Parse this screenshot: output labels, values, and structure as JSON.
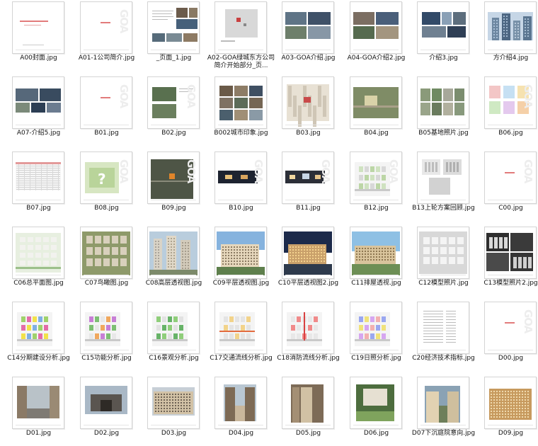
{
  "files": [
    {
      "name": "A00封面.jpg",
      "kind": "cover"
    },
    {
      "name": "A01-1公司简介.jpg",
      "kind": "blank-red"
    },
    {
      "name": "_页面_1.jpg",
      "kind": "text-photos"
    },
    {
      "name": "A02-GOA绿城东方公司简介开始部分_页...",
      "kind": "map"
    },
    {
      "name": "A03-GOA介绍.jpg",
      "kind": "photos4"
    },
    {
      "name": "A04-GOA介绍2.jpg",
      "kind": "photos4b"
    },
    {
      "name": "介绍3.jpg",
      "kind": "photos-mix"
    },
    {
      "name": "方介绍4.jpg",
      "kind": "towers"
    },
    {
      "name": "A07-介绍5.jpg",
      "kind": "aerials"
    },
    {
      "name": "B01.jpg",
      "kind": "blank-red"
    },
    {
      "name": "B02.jpg",
      "kind": "sat2"
    },
    {
      "name": "B002城市印象.jpg",
      "kind": "collage"
    },
    {
      "name": "B03.jpg",
      "kind": "map-light"
    },
    {
      "name": "B04.jpg",
      "kind": "sat-big"
    },
    {
      "name": "B05基地照片.jpg",
      "kind": "site-photos"
    },
    {
      "name": "B06.jpg",
      "kind": "diagram-color"
    },
    {
      "name": "B07.jpg",
      "kind": "table"
    },
    {
      "name": "B08.jpg",
      "kind": "green-plan"
    },
    {
      "name": "B09.jpg",
      "kind": "sat-dark"
    },
    {
      "name": "B10.jpg",
      "kind": "night-strip"
    },
    {
      "name": "B11.jpg",
      "kind": "night-strip2"
    },
    {
      "name": "B12.jpg",
      "kind": "site-plan"
    },
    {
      "name": "B13上轮方案回顾.jpg",
      "kind": "models-white"
    },
    {
      "name": "C00.jpg",
      "kind": "blank-red"
    },
    {
      "name": "C06总平面图.jpg",
      "kind": "masterplan"
    },
    {
      "name": "C07鸟瞰图.jpg",
      "kind": "birdseye"
    },
    {
      "name": "C08高层透视图.jpg",
      "kind": "highrise"
    },
    {
      "name": "C09平层透视图.jpg",
      "kind": "villa"
    },
    {
      "name": "C10平层透视图2.jpg",
      "kind": "night-villa"
    },
    {
      "name": "C11排屋透视.jpg",
      "kind": "townhouse"
    },
    {
      "name": "C12模型照片.jpg",
      "kind": "model-grey"
    },
    {
      "name": "C13模型照片2.jpg",
      "kind": "model-grey2"
    },
    {
      "name": "C14分期建设分析.jpg",
      "kind": "plan-phase"
    },
    {
      "name": "C15功能分析.jpg",
      "kind": "plan-func"
    },
    {
      "name": "C16景观分析.jpg",
      "kind": "plan-land"
    },
    {
      "name": "C17交通流线分析.jpg",
      "kind": "plan-traffic"
    },
    {
      "name": "C18消防流线分析.jpg",
      "kind": "plan-fire"
    },
    {
      "name": "C19日照分析.jpg",
      "kind": "plan-sun"
    },
    {
      "name": "C20经济技术指标.jpg",
      "kind": "list"
    },
    {
      "name": "D00.jpg",
      "kind": "blank-red"
    },
    {
      "name": "D01.jpg",
      "kind": "street"
    },
    {
      "name": "D02.jpg",
      "kind": "gate"
    },
    {
      "name": "D03.jpg",
      "kind": "facade"
    },
    {
      "name": "D04.jpg",
      "kind": "arch"
    },
    {
      "name": "D05.jpg",
      "kind": "lane"
    },
    {
      "name": "D06.jpg",
      "kind": "garden"
    },
    {
      "name": "D07下沉庭院意向.jpg",
      "kind": "courtyard"
    },
    {
      "name": "D09.jpg",
      "kind": "brick"
    }
  ]
}
